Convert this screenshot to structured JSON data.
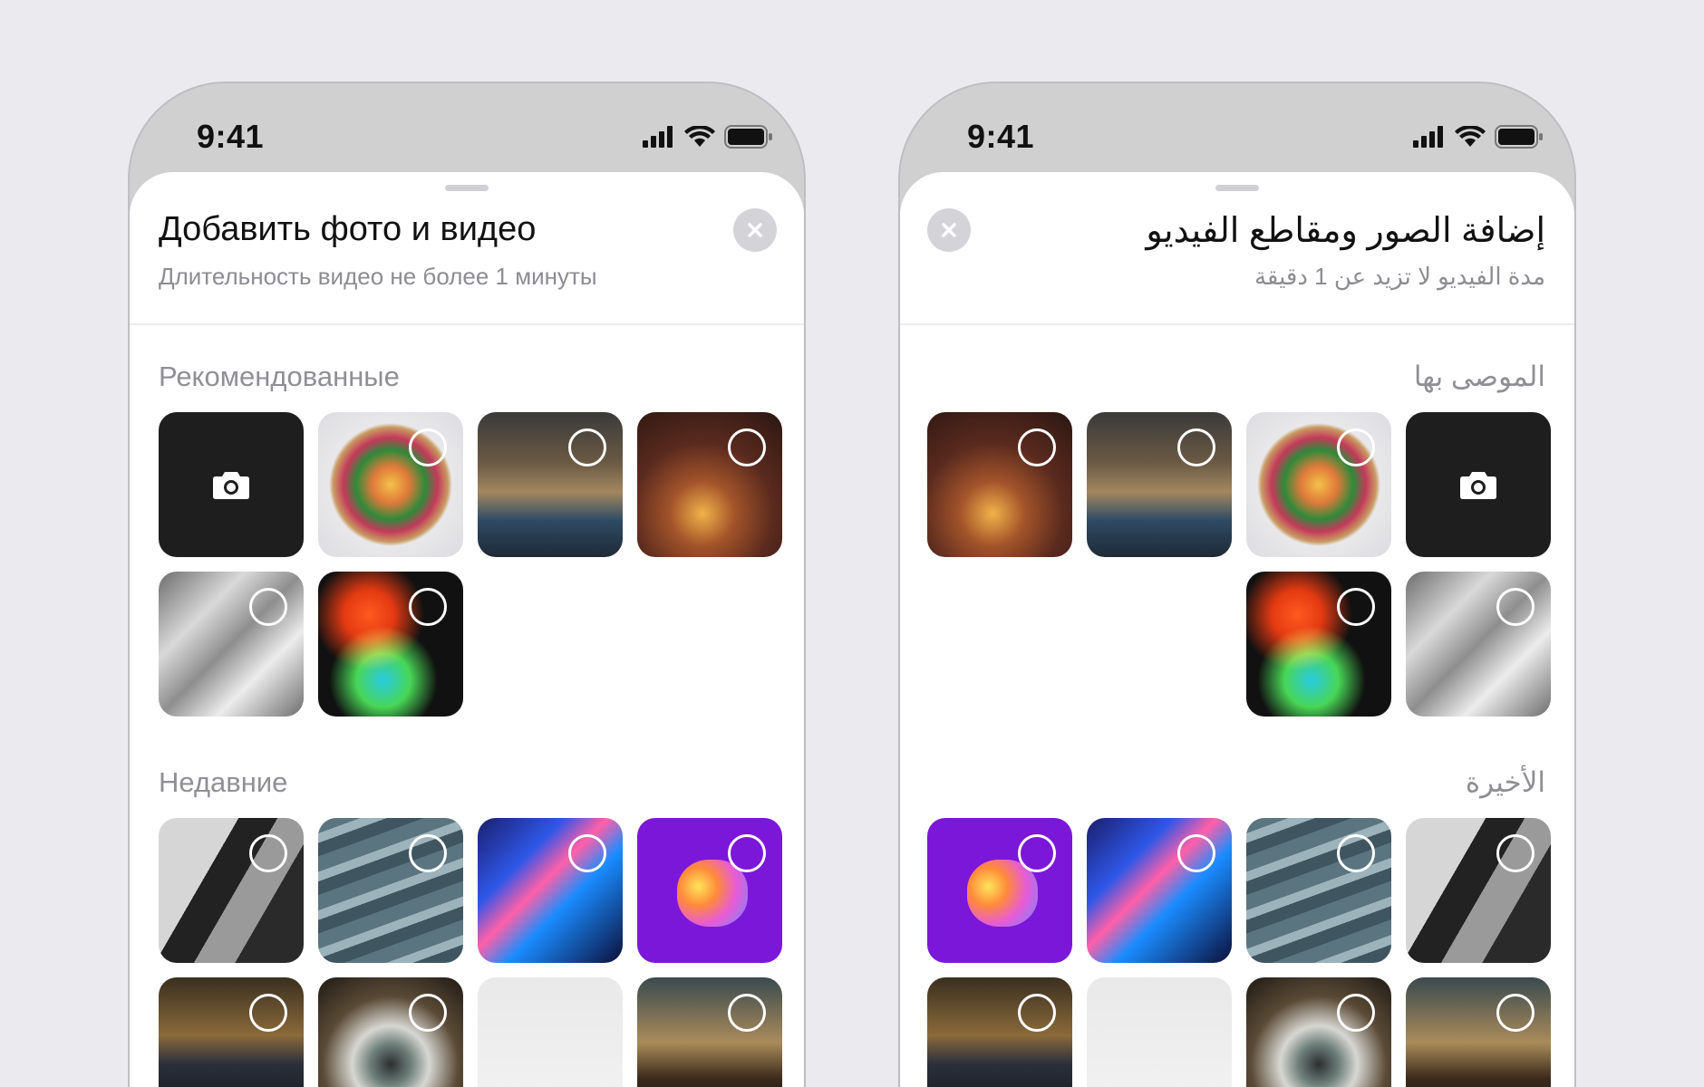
{
  "colors": {
    "background": "#ebebef",
    "sheet": "#ffffff",
    "camera_tile": "#1e1e1e",
    "close_button": "#d3d3d8"
  },
  "phones": {
    "ru": {
      "time": "9:41",
      "title": "Добавить фото и видео",
      "subtitle": "Длительность видео не более 1 минуты",
      "section_recommended": "Рекомендованные",
      "section_recent": "Недавние"
    },
    "ar": {
      "time": "9:41",
      "title": "إضافة الصور ومقاطع الفيديو",
      "subtitle": "مدة الفيديو لا تزيد عن 1 دقيقة",
      "section_recommended": "الموصى بها",
      "section_recent": "الأخيرة"
    }
  },
  "icons": [
    "cellular-signal-icon",
    "wifi-icon",
    "battery-icon",
    "close-icon",
    "camera-icon",
    "selection-circle-icon"
  ]
}
